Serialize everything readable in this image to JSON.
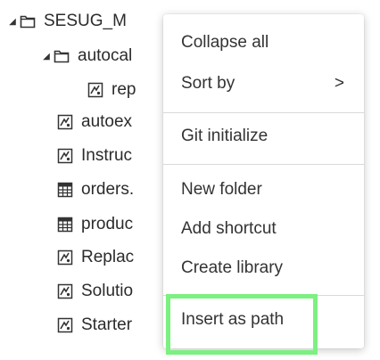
{
  "tree": {
    "root": {
      "label": "SESUG_M",
      "label_tail": "...",
      "icon": "folder-icon"
    },
    "items": [
      {
        "label": "autocal",
        "icon": "folder-icon",
        "expanded": true
      },
      {
        "label": "rep",
        "icon": "program-icon"
      },
      {
        "label": "autoex",
        "icon": "program-icon"
      },
      {
        "label": "Instruc",
        "icon": "program-icon"
      },
      {
        "label": "orders.",
        "icon": "table-icon"
      },
      {
        "label": "produc",
        "icon": "table-icon"
      },
      {
        "label": "Replac",
        "icon": "program-icon"
      },
      {
        "label": "Solutio",
        "icon": "program-icon"
      },
      {
        "label": "Starter",
        "icon": "program-icon"
      }
    ]
  },
  "context_menu": {
    "items": [
      {
        "label": "Collapse all"
      },
      {
        "label": "Sort by",
        "submenu_indicator": ">"
      },
      {
        "label": "Git initialize"
      },
      {
        "label": "New folder"
      },
      {
        "label": "Add shortcut"
      },
      {
        "label": "Create library"
      },
      {
        "label": "Insert as path",
        "highlighted": true
      }
    ]
  },
  "colors": {
    "highlight_border": "#7cf080",
    "text": "#333333",
    "separator": "#d9d9d9"
  }
}
